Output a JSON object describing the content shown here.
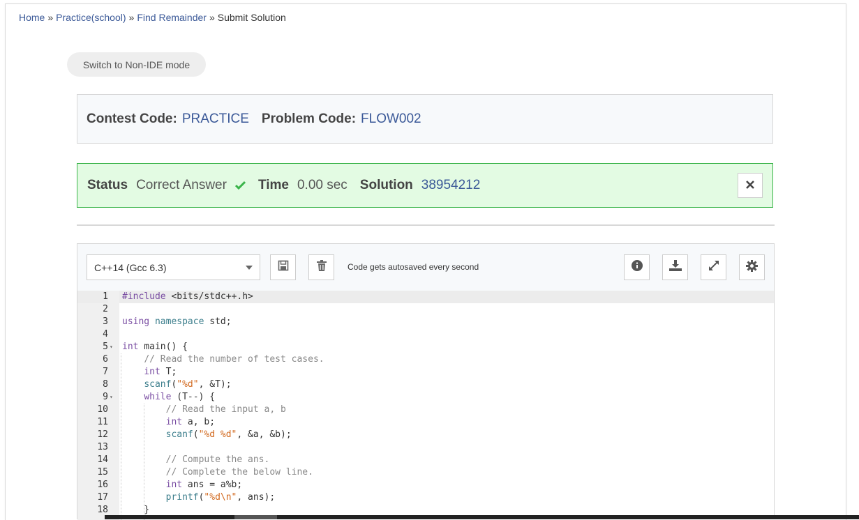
{
  "breadcrumb": {
    "items": [
      "Home",
      "Practice(school)",
      "Find Remainder"
    ],
    "current": "Submit Solution",
    "separator": "»"
  },
  "mode_button": "Switch to Non-IDE mode",
  "codes": {
    "contest_label": "Contest Code:",
    "contest_value": "PRACTICE",
    "problem_label": "Problem Code:",
    "problem_value": "FLOW002"
  },
  "status": {
    "status_label": "Status",
    "status_value": "Correct Answer",
    "time_label": "Time",
    "time_value": "0.00 sec",
    "solution_label": "Solution",
    "solution_value": "38954212",
    "accent": "#3ab44a",
    "background": "#e3fbe3"
  },
  "toolbar": {
    "language": "C++14 (Gcc 6.3)",
    "autosave_text": "Code gets autosaved every second",
    "icons": [
      "save-icon",
      "trash-icon",
      "info-icon",
      "download-icon",
      "expand-icon",
      "settings-icon"
    ]
  },
  "editor": {
    "active_line": 1,
    "lines": [
      {
        "num": "1",
        "text": "#include <bits/stdc++.h>"
      },
      {
        "num": "2",
        "text": ""
      },
      {
        "num": "3",
        "text": "using namespace std;"
      },
      {
        "num": "4",
        "text": ""
      },
      {
        "num": "5",
        "text": "int main() {",
        "fold": true
      },
      {
        "num": "6",
        "text": "    // Read the number of test cases."
      },
      {
        "num": "7",
        "text": "    int T;"
      },
      {
        "num": "8",
        "text": "    scanf(\"%d\", &T);"
      },
      {
        "num": "9",
        "text": "    while (T--) {",
        "fold": true
      },
      {
        "num": "10",
        "text": "        // Read the input a, b"
      },
      {
        "num": "11",
        "text": "        int a, b;"
      },
      {
        "num": "12",
        "text": "        scanf(\"%d %d\", &a, &b);"
      },
      {
        "num": "13",
        "text": ""
      },
      {
        "num": "14",
        "text": "        // Compute the ans."
      },
      {
        "num": "15",
        "text": "        // Complete the below line."
      },
      {
        "num": "16",
        "text": "        int ans = a%b;"
      },
      {
        "num": "17",
        "text": "        printf(\"%d\\n\", ans);"
      },
      {
        "num": "18",
        "text": "    }"
      }
    ]
  }
}
